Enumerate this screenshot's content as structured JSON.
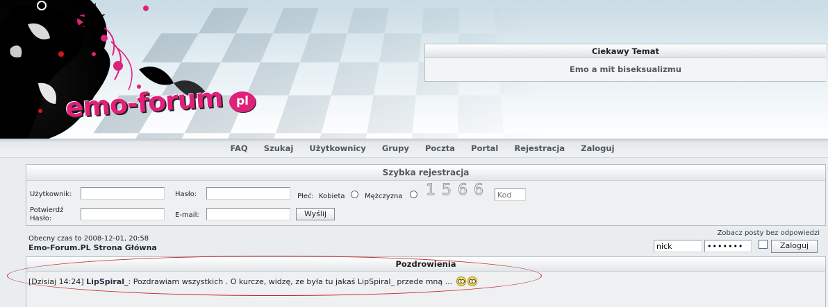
{
  "header": {
    "logo_text": "emo-forum",
    "logo_suffix": "pl",
    "cool_topic": {
      "title": "Ciekawy Temat",
      "link": "Emo a mit biseksualizmu"
    }
  },
  "nav": {
    "items": [
      "FAQ",
      "Szukaj",
      "Użytkownicy",
      "Grupy",
      "Poczta",
      "Portal",
      "Rejestracja",
      "Zaloguj"
    ]
  },
  "quick_registration": {
    "title": "Szybka rejestracja",
    "username_label": "Użytkownik:",
    "username_value": "",
    "password_label": "Hasło:",
    "password_value": "",
    "gender_label": "Płeć:",
    "gender_female": "Kobieta",
    "gender_male": "Mężczyzna",
    "captcha_text": "1566",
    "code_placeholder": "Kod",
    "confirm_label_line1": "Potwierdź",
    "confirm_label_line2": "Hasło:",
    "confirm_value": "",
    "email_label": "E-mail:",
    "email_value": "",
    "submit_label": "Wyślij"
  },
  "info": {
    "current_time": "Obecny czas to 2008-12-01, 20:58",
    "home_link": "Emo-Forum.PL Strona Główna",
    "unanswered_link": "Zobacz posty bez odpowiedzi"
  },
  "login": {
    "nick_value": "nick",
    "password_value": "•••••••",
    "button_label": "Zaloguj"
  },
  "shoutbox": {
    "title": "Pozdrowienia",
    "entries": [
      {
        "timestamp": "[Dzisiaj 14:24]",
        "author": "LipSpiral_",
        "message": ": Pozdrawiam wszystkich . O kurcze, widzę, ze była tu jakaś LipSpiral_ przede mną ..."
      }
    ]
  },
  "colors": {
    "brand_pink": "#e0207a",
    "highlight_ellipse": "#c4262a"
  }
}
